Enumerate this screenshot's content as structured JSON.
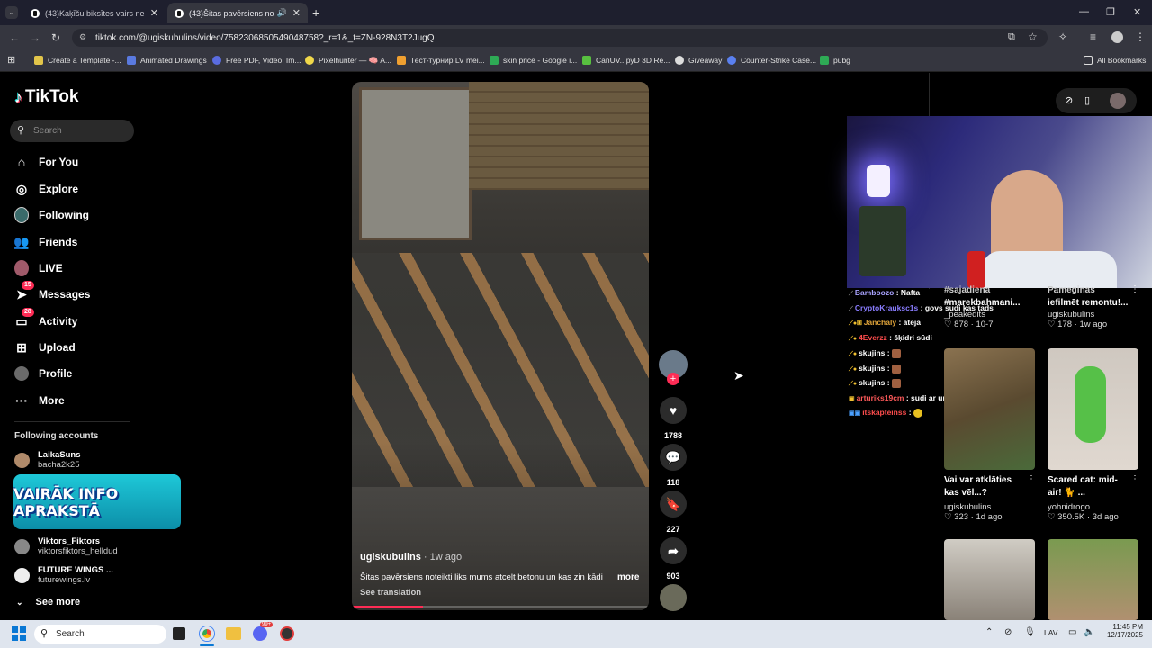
{
  "browser": {
    "tabs": [
      {
        "title": "(43)Kaķīšu biksītes vairs nebūs!"
      },
      {
        "title": "(43)Šitas pavērsiens noteikti"
      }
    ],
    "url": "tiktok.com/@ugiskubulins/video/7582306850549048758?_r=1&_t=ZN-928N3T2JugQ",
    "bookmarks": [
      "Create a Template -...",
      "Animated Drawings",
      "Free PDF, Video, Im...",
      "Pixelhunter — 🧠 A...",
      "Тест-турнир LV mei...",
      "skin price - Google i...",
      "CanUV...pyD 3D Re...",
      "Giveaway",
      "Counter-Strike Case...",
      "pubg"
    ],
    "all_bookmarks": "All Bookmarks"
  },
  "sidebar": {
    "logo": "TikTok",
    "search_placeholder": "Search",
    "nav": [
      {
        "label": "For You",
        "icon": "home-icon"
      },
      {
        "label": "Explore",
        "icon": "compass-icon"
      },
      {
        "label": "Following",
        "icon": "avatar-icon"
      },
      {
        "label": "Friends",
        "icon": "friends-icon"
      },
      {
        "label": "LIVE",
        "icon": "avatar-icon"
      },
      {
        "label": "Messages",
        "icon": "send-icon",
        "badge": "15"
      },
      {
        "label": "Activity",
        "icon": "inbox-icon",
        "badge": "28"
      },
      {
        "label": "Upload",
        "icon": "plus-square-icon"
      },
      {
        "label": "Profile",
        "icon": "avatar-icon"
      },
      {
        "label": "More",
        "icon": "ellipsis-icon"
      }
    ],
    "following_heading": "Following accounts",
    "accounts": [
      {
        "name": "LaikaSuns",
        "handle": "bacha2k25"
      },
      {
        "name": "Viktors_Fiktors",
        "handle": "viktorsfiktors_helldud"
      },
      {
        "name": "FUTURE WINGS ...",
        "handle": "futurewings.lv"
      }
    ],
    "banner_text": "VAIRĀK INFO APRAKSTĀ",
    "see_more": "See more"
  },
  "video": {
    "author": "ugiskubulins",
    "age": "· 1w ago",
    "caption": "Šitas pavērsiens noteikti liks mums atcelt betonu un kas zin kādi",
    "more": "more",
    "see_translation": "See translation",
    "progress": 0.24,
    "likes": "1788",
    "comments": "118",
    "saves": "227",
    "shares": "903"
  },
  "chat": [
    {
      "user": "Bamboozo",
      "msg": ": Nafta",
      "color": "#a9a3ff"
    },
    {
      "user": "CryptoKrauksc1s",
      "msg": ": govs sudi kas tads",
      "color": "#8a7dff"
    },
    {
      "user": "Janchaly",
      "msg": ": ateja",
      "color": "#e0a43a"
    },
    {
      "user": "4Everzz",
      "msg": ": šķidri sūdi",
      "color": "#ff4d4d"
    },
    {
      "user": "skujins",
      "msg": ":",
      "color": "#ffffff"
    },
    {
      "user": "skujins",
      "msg": ":",
      "color": "#ffffff"
    },
    {
      "user": "skujins",
      "msg": ":",
      "color": "#ffffff"
    },
    {
      "user": "arturiks19cm",
      "msg": ": sudi ar urinu",
      "color": "#ff5a5a"
    },
    {
      "user": "itskapteinss",
      "msg": ":",
      "color": "#ff4d4d"
    }
  ],
  "cards": [
    {
      "title1": "#sajadiena",
      "title2": "#marekbahmani...",
      "user": "_peakedits",
      "likes": "878",
      "date": "10-7"
    },
    {
      "title1": "Pameginas",
      "title2": "iefilmēt remontu!...",
      "user": "ugiskubulins",
      "likes": "178",
      "date": "1w ago"
    },
    {
      "title1": "Vai var atklāties",
      "title2": "kas vēl...?",
      "user": "ugiskubulins",
      "likes": "323",
      "date": "1d ago"
    },
    {
      "title1": "Scared cat: mid-",
      "title2": "air! 🐈 ...",
      "user": "yohnidrogo",
      "likes": "350.5K",
      "date": "3d ago"
    }
  ],
  "taskbar": {
    "search": "Search",
    "lang": "LAV",
    "time": "11:45 PM",
    "date": "12/17/2025",
    "chat_badge": "99+"
  },
  "colors": {
    "accent": "#fe2c55",
    "bg": "#000000"
  }
}
